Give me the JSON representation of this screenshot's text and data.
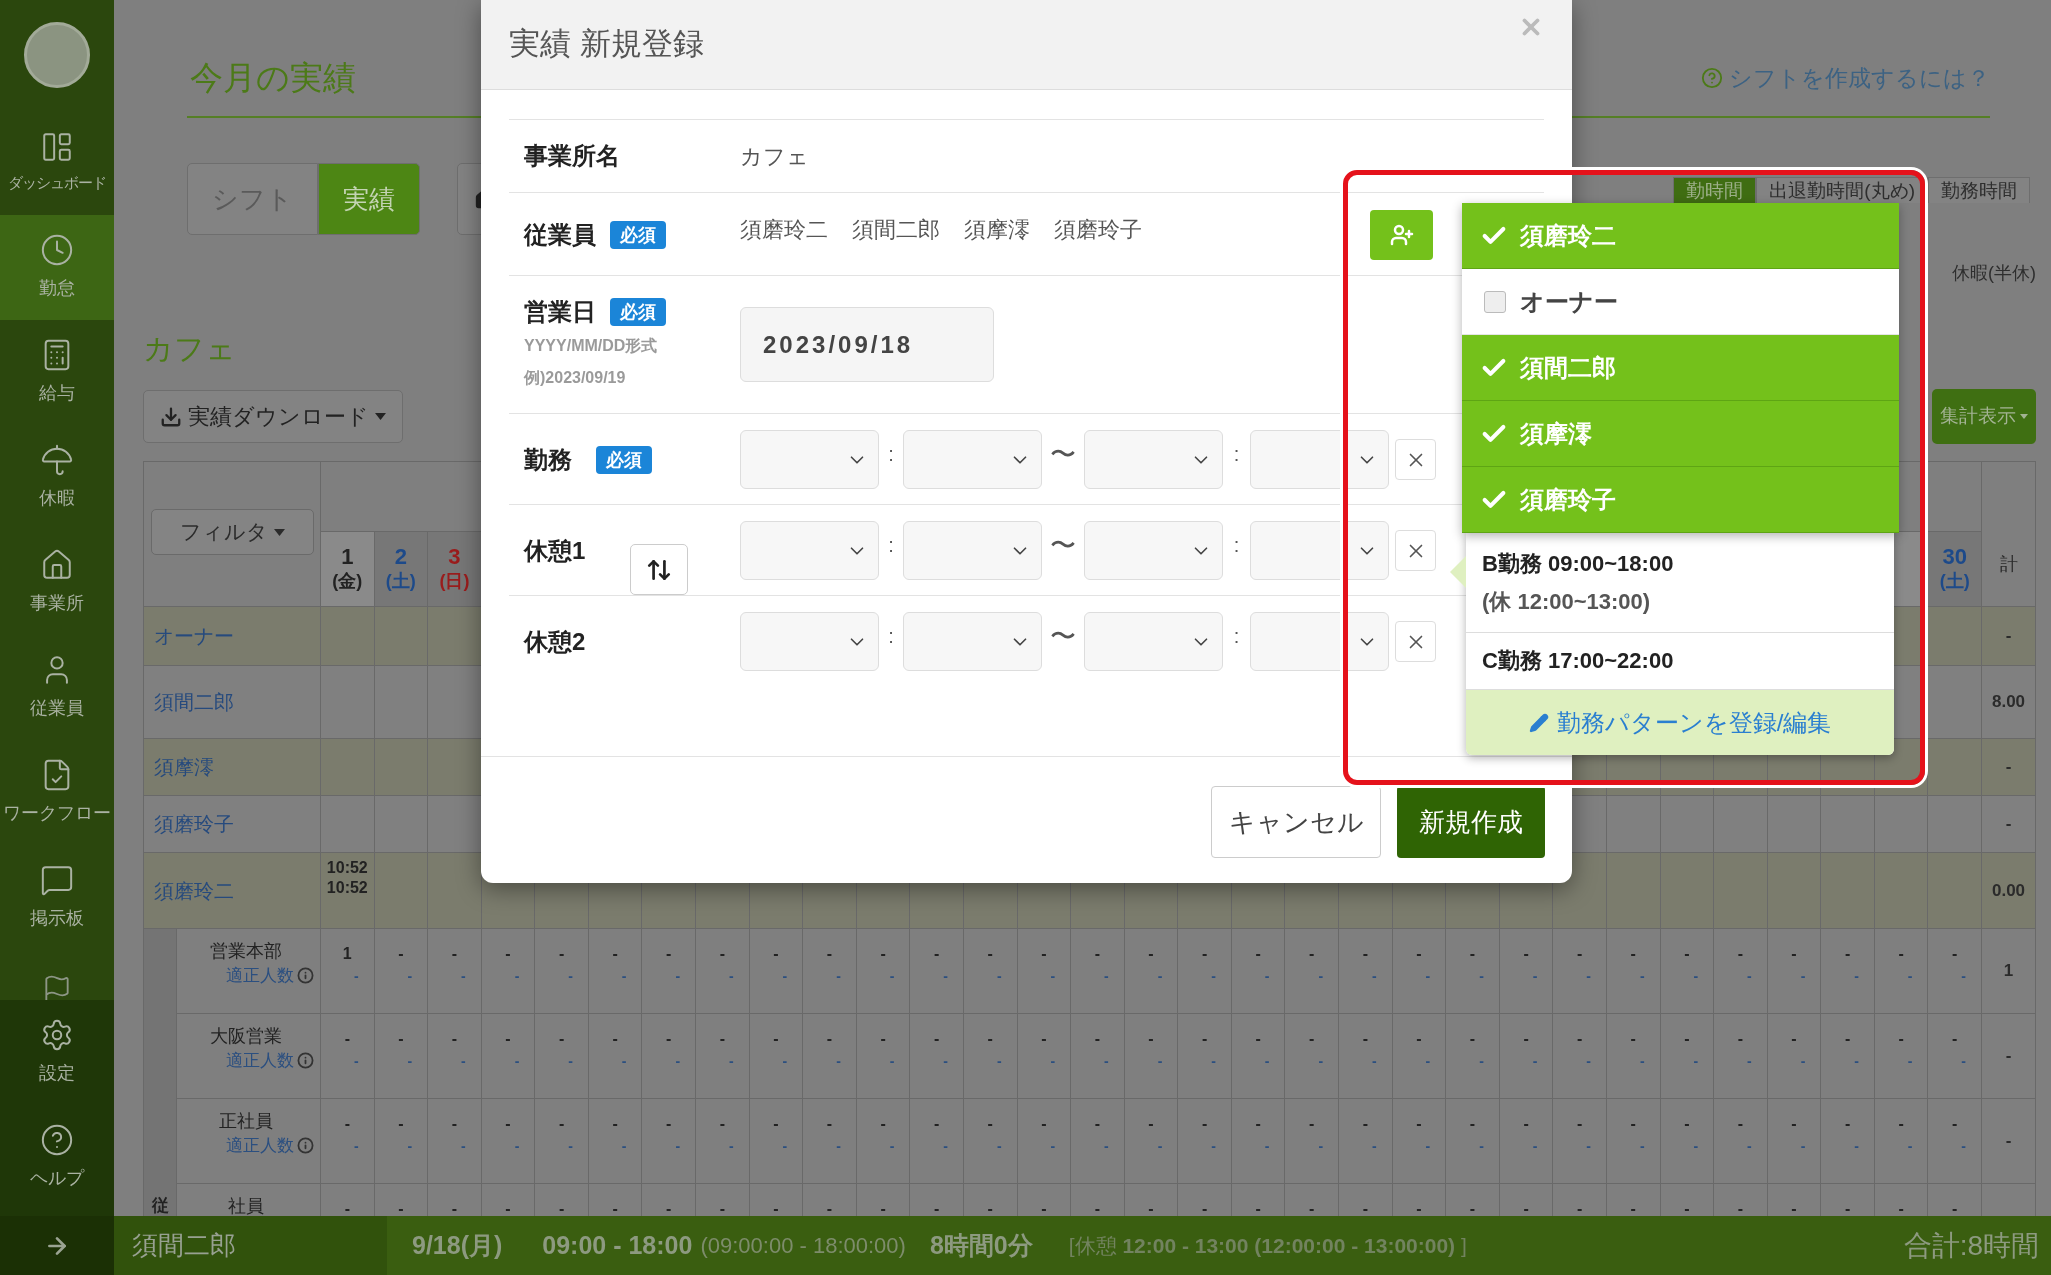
{
  "sidebar": {
    "items": [
      {
        "label": "ダッシュボード",
        "selected": false
      },
      {
        "label": "勤怠",
        "selected": true
      },
      {
        "label": "給与",
        "selected": false
      },
      {
        "label": "休暇",
        "selected": false
      },
      {
        "label": "事業所",
        "selected": false
      },
      {
        "label": "従業員",
        "selected": false
      },
      {
        "label": "ワークフロー",
        "selected": false
      },
      {
        "label": "掲示板",
        "selected": false
      }
    ],
    "bottom_items": [
      {
        "label": "設定",
        "selected": false
      },
      {
        "label": "ヘルプ",
        "selected": false
      }
    ]
  },
  "page_title": "今月の実績",
  "help_link": "シフトを作成するには？",
  "view_toggle": [
    {
      "label": "シフト",
      "selected": false
    },
    {
      "label": "実績",
      "selected": true
    }
  ],
  "display_tabs": [
    {
      "label": "勤時間",
      "selected": true
    },
    {
      "label": "出退勤時間(丸め)",
      "selected": false
    },
    {
      "label": "勤務時間",
      "selected": false
    }
  ],
  "legend": "休暇(半休)",
  "office_heading": "カフェ",
  "download_button": "実績ダウンロード",
  "summary_button": "集計表示",
  "table": {
    "filter_button": "フィルタ",
    "days_left": [
      {
        "day": "1",
        "weekday": "(金)",
        "kind": "weekday"
      },
      {
        "day": "2",
        "weekday": "(土)",
        "kind": "saturday"
      },
      {
        "day": "3",
        "weekday": "(日)",
        "kind": "sunday"
      }
    ],
    "days_right": [
      {
        "day": "30",
        "weekday": "(土)",
        "kind": "saturday"
      }
    ],
    "total_header": "計",
    "employees": [
      {
        "name": "オーナー",
        "total": "-"
      },
      {
        "name": "須間二郎",
        "total": "8.00"
      },
      {
        "name": "須摩澪",
        "total": "-"
      },
      {
        "name": "須磨玲子",
        "total": "-"
      },
      {
        "name": "須磨玲二",
        "first_day": [
          "10:52",
          "10:52"
        ],
        "total": "0.00"
      }
    ],
    "group_strip_label": "従",
    "groups": [
      {
        "label": "営業本部",
        "note": "適正人数",
        "total": "1",
        "counts": [
          "1",
          "-",
          "-",
          "-",
          "-",
          "-",
          "-",
          "-",
          "-",
          "-",
          "-",
          "-",
          "-",
          "-",
          "-",
          "-",
          "-",
          "-",
          "-",
          "-",
          "-",
          "-",
          "-",
          "-",
          "-",
          "-",
          "-",
          "-",
          "-",
          "-",
          "-"
        ],
        "targets": [
          "-",
          "-",
          "-",
          "-",
          "-",
          "-",
          "-",
          "-",
          "-",
          "-",
          "-",
          "-",
          "-",
          "-",
          "-",
          "-",
          "-",
          "-",
          "-",
          "-",
          "-",
          "-",
          "-",
          "-",
          "-",
          "-",
          "-",
          "-",
          "-",
          "-",
          "-"
        ]
      },
      {
        "label": "大阪営業",
        "note": "適正人数",
        "total": "-",
        "counts": [
          "-",
          "-",
          "-",
          "-",
          "-",
          "-",
          "-",
          "-",
          "-",
          "-",
          "-",
          "-",
          "-",
          "-",
          "-",
          "-",
          "-",
          "-",
          "-",
          "-",
          "-",
          "-",
          "-",
          "-",
          "-",
          "-",
          "-",
          "-",
          "-",
          "-",
          "-"
        ],
        "targets": [
          "-",
          "-",
          "-",
          "-",
          "-",
          "-",
          "-",
          "-",
          "-",
          "-",
          "-",
          "-",
          "-",
          "-",
          "-",
          "-",
          "-",
          "-",
          "-",
          "-",
          "-",
          "-",
          "-",
          "-",
          "-",
          "-",
          "-",
          "-",
          "-",
          "-",
          "-"
        ]
      },
      {
        "label": "正社員",
        "note": "適正人数",
        "total": "-",
        "counts": [
          "-",
          "-",
          "-",
          "-",
          "-",
          "-",
          "-",
          "-",
          "-",
          "-",
          "-",
          "-",
          "-",
          "-",
          "-",
          "-",
          "-",
          "-",
          "-",
          "-",
          "-",
          "-",
          "-",
          "-",
          "-",
          "-",
          "-",
          "-",
          "-",
          "-",
          "-"
        ],
        "targets": [
          "-",
          "-",
          "-",
          "-",
          "-",
          "-",
          "-",
          "-",
          "-",
          "-",
          "-",
          "-",
          "-",
          "-",
          "-",
          "-",
          "-",
          "-",
          "-",
          "-",
          "-",
          "-",
          "-",
          "-",
          "-",
          "-",
          "-",
          "-",
          "-",
          "-",
          "-"
        ]
      },
      {
        "label": "社員",
        "counts": [
          "-",
          "-",
          "-",
          "-",
          "-",
          "-",
          "-",
          "-",
          "-",
          "-",
          "-",
          "-",
          "-",
          "-",
          "-",
          "-",
          "-",
          "-",
          "-",
          "-",
          "-",
          "-",
          "-",
          "-",
          "-",
          "-",
          "-",
          "-",
          "-",
          "-",
          "-"
        ]
      }
    ]
  },
  "status_bar": {
    "employee": "須間二郎",
    "date": "9/18(月)",
    "time": "09:00 - 18:00",
    "time_detail": "(09:00:00 - 18:00:00)",
    "duration": "8時間0分",
    "break": "[休憩 **12:00 - 13:00 (12:00:00 - 13:00:00)** ]",
    "total": "合計:8時間"
  },
  "modal": {
    "title": "実績 新規登録",
    "office": {
      "label": "事業所名",
      "value": "カフェ"
    },
    "employees": {
      "label": "従業員",
      "badge": "必須",
      "names": [
        "須磨玲二",
        "須間二郎",
        "須摩澪",
        "須磨玲子"
      ]
    },
    "date": {
      "label": "営業日",
      "badge": "必須",
      "hints": [
        "YYYY/MM/DD形式",
        "例)2023/09/19"
      ],
      "value": "2023/09/18"
    },
    "time_rows": [
      {
        "label": "勤務",
        "badge": "必須",
        "separators": [
          ":",
          "〜",
          ":"
        ]
      },
      {
        "label": "休憩1",
        "separators": [
          ":",
          "〜",
          ":"
        ]
      },
      {
        "label": "休憩2",
        "separators": [
          ":",
          "〜",
          ":"
        ]
      }
    ],
    "buttons": [
      {
        "label": "キャンセル",
        "kind": "secondary"
      },
      {
        "label": "新規作成",
        "kind": "primary"
      }
    ]
  },
  "employee_dropdown": {
    "options": [
      {
        "label": "須磨玲二",
        "checked": true
      },
      {
        "label": "オーナー",
        "checked": false
      },
      {
        "label": "須間二郎",
        "checked": true
      },
      {
        "label": "須摩澪",
        "checked": true
      },
      {
        "label": "須磨玲子",
        "checked": true
      }
    ]
  },
  "pattern_popover": {
    "patterns": [
      {
        "lines": [
          "B勤務 09:00~18:00",
          "(休 12:00~13:00)"
        ]
      },
      {
        "lines": [
          "C勤務 17:00~22:00"
        ]
      }
    ],
    "edit_link": "勤務パターンを登録/編集"
  }
}
